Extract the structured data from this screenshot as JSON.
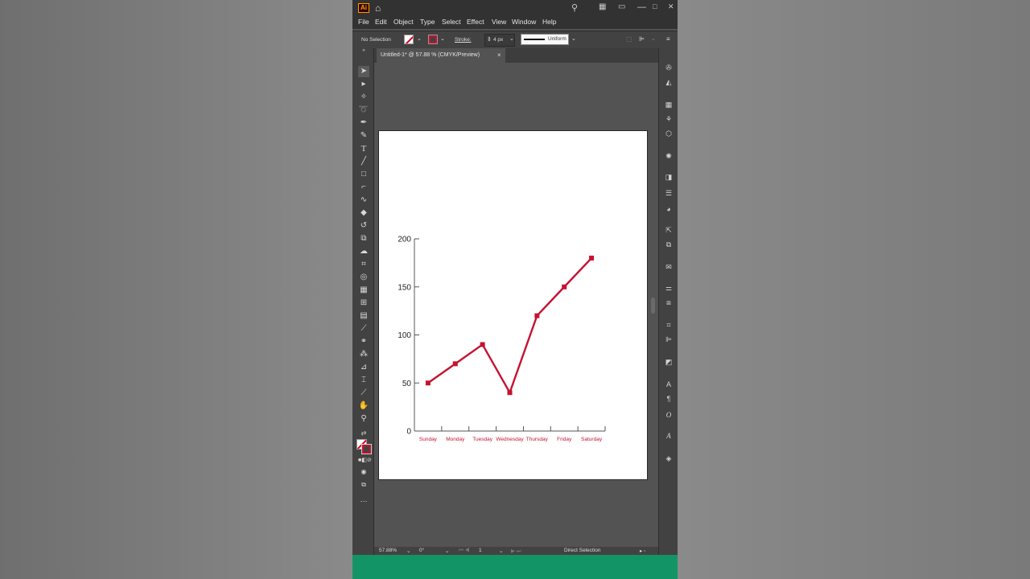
{
  "app": {
    "logo_text": "Ai",
    "window_controls": [
      "—",
      "□",
      "✕"
    ]
  },
  "menu": {
    "items": [
      "File",
      "Edit",
      "Object",
      "Type",
      "Select",
      "Effect",
      "View",
      "Window",
      "Help"
    ]
  },
  "control_bar": {
    "selection_label": "No Selection",
    "stroke_label": "Stroke:",
    "stroke_value": "4 px",
    "profile_label": "Uniform"
  },
  "document": {
    "tab_title": "Untitled-1* @ 57.88 % (CMYK/Preview)",
    "close_symbol": "×"
  },
  "status_bar": {
    "zoom": "57.88%",
    "rotation": "0°",
    "artboard_number": "1",
    "current_tool": "Direct Selection"
  },
  "colors": {
    "accent_line": "#c41230",
    "accent_green": "#139467"
  },
  "icons": {
    "toolbar": [
      "selection-tool-icon",
      "direct-selection-tool-icon",
      "magic-wand-icon",
      "lasso-icon",
      "pen-tool-icon",
      "curvature-tool-icon",
      "type-tool-icon",
      "line-tool-icon",
      "rectangle-tool-icon",
      "paintbrush-icon",
      "shaper-tool-icon",
      "eraser-icon",
      "rotate-tool-icon",
      "scale-tool-icon",
      "warp-tool-icon",
      "free-transform-icon",
      "shape-builder-icon",
      "perspective-grid-icon",
      "mesh-tool-icon",
      "gradient-tool-icon",
      "eyedropper-icon",
      "blend-tool-icon",
      "symbol-sprayer-icon",
      "graph-tool-icon",
      "artboard-tool-icon",
      "slice-tool-icon",
      "hand-tool-icon",
      "zoom-tool-icon"
    ]
  },
  "chart_data": {
    "type": "line",
    "categories": [
      "Sunday",
      "Monday",
      "Tuesday",
      "Wednesday",
      "Thursday",
      "Friday",
      "Saturday"
    ],
    "series": [
      {
        "values": [
          50,
          70,
          90,
          40,
          120,
          150,
          180
        ]
      }
    ],
    "y_ticks": [
      "0",
      "50",
      "100",
      "150",
      "200"
    ],
    "ylim": [
      0,
      200
    ],
    "grid": false,
    "line_color": "#c41230",
    "label_color": "#c41230"
  }
}
